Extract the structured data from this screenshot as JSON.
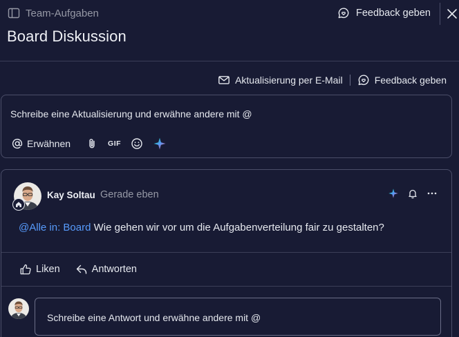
{
  "header": {
    "breadcrumb_label": "Team-Aufgaben",
    "feedback_label": "Feedback geben",
    "title": "Board Diskussion"
  },
  "actions": {
    "email_label": "Aktualisierung per E-Mail",
    "feedback_label": "Feedback geben"
  },
  "composer": {
    "placeholder": "Schreibe eine Aktualisierung und erwähne andere mit @",
    "mention_label": "Erwähnen",
    "gif_label": "GIF"
  },
  "post": {
    "author": "Kay Soltau",
    "time": "Gerade eben",
    "mention": "@Alle in: Board",
    "text": " Wie gehen wir vor um die Aufgabenverteilung fair zu gestalten?",
    "like_label": "Liken",
    "reply_label": "Antworten",
    "reply_placeholder": "Schreibe eine Antwort und erwähne andere mit @"
  },
  "colors": {
    "background": "#181b34",
    "mention": "#579bfc",
    "border": "#4b4e69",
    "muted_text": "#9699a6"
  }
}
